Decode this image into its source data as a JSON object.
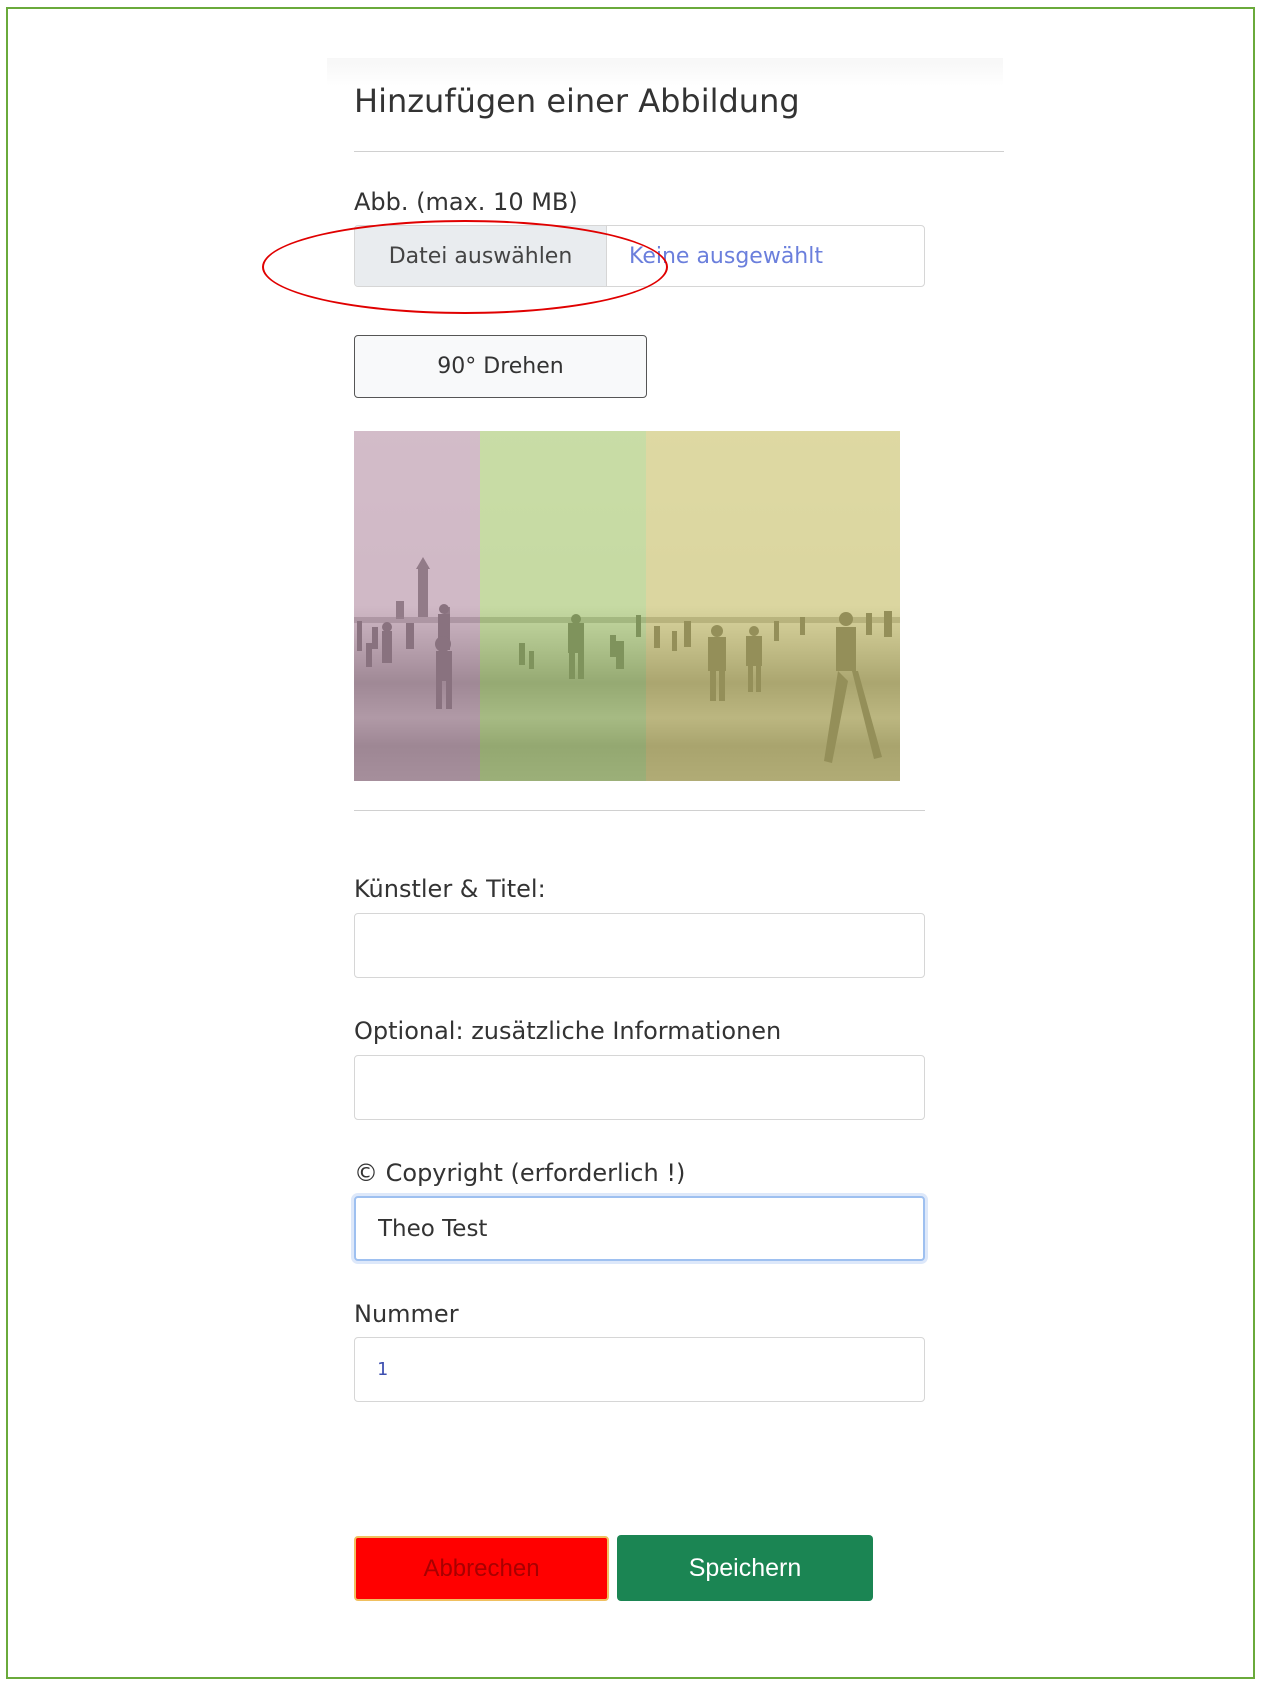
{
  "modal": {
    "title": "Hinzufügen einer Abbildung"
  },
  "image_upload": {
    "label": "Abb. (max. 10 MB)",
    "choose_button": "Datei auswählen",
    "file_status": "Keine ausgewählt",
    "rotate_button": "90° Drehen"
  },
  "fields": {
    "artist_title": {
      "label": "Künstler & Titel:",
      "value": ""
    },
    "extra_info": {
      "label": "Optional: zusätzliche Informationen",
      "value": ""
    },
    "copyright": {
      "label": "© Copyright (erforderlich !)",
      "value": "Theo Test"
    },
    "number": {
      "label": "Nummer",
      "value": "1"
    }
  },
  "actions": {
    "cancel": "Abbrechen",
    "save": "Speichern"
  },
  "colors": {
    "frame_border": "#6aaa3b",
    "highlight_ellipse": "#e00000",
    "cancel_bg": "#ff0000",
    "save_bg": "#1b8553",
    "preview_tints": [
      "#c8aab8",
      "#c9dea0",
      "#dcd890"
    ]
  }
}
